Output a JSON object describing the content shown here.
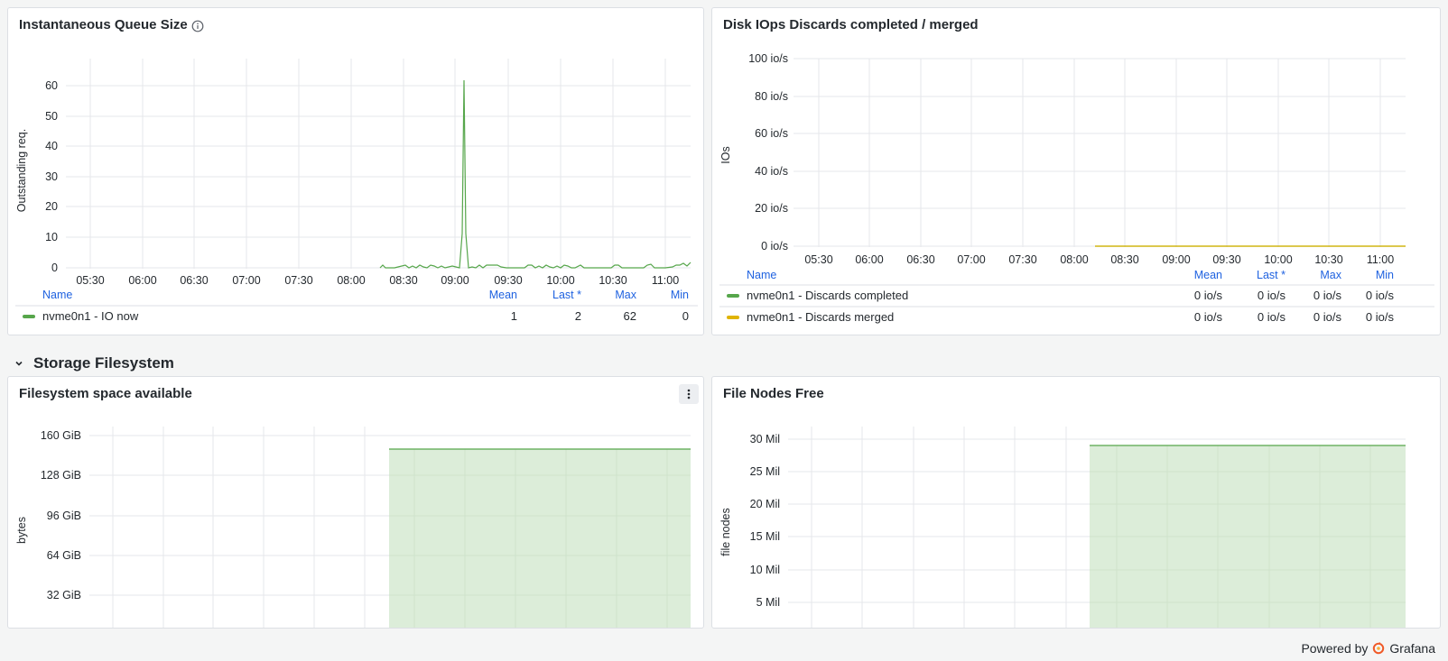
{
  "colors": {
    "green": "#56a64b",
    "yellow": "#e0b400",
    "area_fill": "#dcedd9",
    "legend_header": "#1f62e0"
  },
  "panel_queue": {
    "title": "Instantaneous Queue Size",
    "ylabel": "Outstanding req.",
    "yticks": [
      "60",
      "50",
      "40",
      "30",
      "20",
      "10",
      "0"
    ],
    "xticks": [
      "05:30",
      "06:00",
      "06:30",
      "07:00",
      "07:30",
      "08:00",
      "08:30",
      "09:00",
      "09:30",
      "10:00",
      "10:30",
      "11:00"
    ],
    "legend": {
      "headers": {
        "name": "Name",
        "mean": "Mean",
        "last": "Last *",
        "max": "Max",
        "min": "Min"
      },
      "rows": [
        {
          "name": "nvme0n1 - IO now",
          "mean": "1",
          "last": "2",
          "max": "62",
          "min": "0"
        }
      ]
    }
  },
  "panel_discards": {
    "title": "Disk IOps Discards completed / merged",
    "ylabel": "IOs",
    "yticks": [
      "100 io/s",
      "80 io/s",
      "60 io/s",
      "40 io/s",
      "20 io/s",
      "0 io/s"
    ],
    "xticks": [
      "05:30",
      "06:00",
      "06:30",
      "07:00",
      "07:30",
      "08:00",
      "08:30",
      "09:00",
      "09:30",
      "10:00",
      "10:30",
      "11:00"
    ],
    "legend": {
      "headers": {
        "name": "Name",
        "mean": "Mean",
        "last": "Last *",
        "max": "Max",
        "min": "Min"
      },
      "rows": [
        {
          "name": "nvme0n1 - Discards completed",
          "mean": "0 io/s",
          "last": "0 io/s",
          "max": "0 io/s",
          "min": "0 io/s"
        },
        {
          "name": "nvme0n1 - Discards merged",
          "mean": "0 io/s",
          "last": "0 io/s",
          "max": "0 io/s",
          "min": "0 io/s"
        }
      ]
    }
  },
  "row": {
    "title": "Storage Filesystem"
  },
  "panel_fs": {
    "title": "Filesystem space available",
    "ylabel": "bytes",
    "yticks": [
      "160 GiB",
      "128 GiB",
      "96 GiB",
      "64 GiB",
      "32 GiB"
    ]
  },
  "panel_inodes": {
    "title": "File Nodes Free",
    "ylabel": "file nodes",
    "yticks": [
      "30 Mil",
      "25 Mil",
      "20 Mil",
      "15 Mil",
      "10 Mil",
      "5 Mil"
    ]
  },
  "footer": {
    "powered_by": "Powered by",
    "brand": "Grafana"
  }
}
